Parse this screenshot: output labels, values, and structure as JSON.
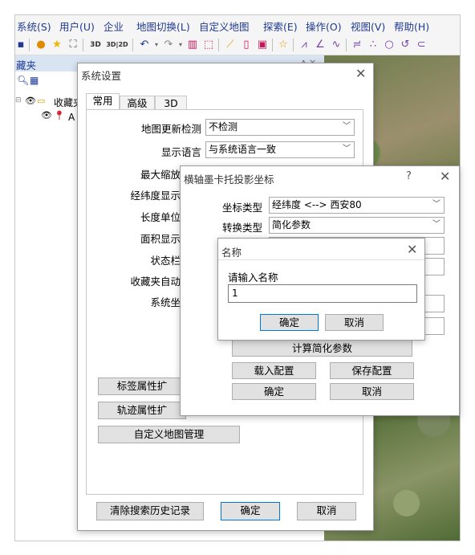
{
  "menu": [
    "系统(S)",
    "用户(U)",
    "企业",
    "地图切换(L)",
    "自定义地图",
    "探索(E)",
    "操作(O)",
    "视图(V)",
    "帮助(H)"
  ],
  "toolbar": {
    "btn_3d": "3D",
    "btn_32d": "3D|2D"
  },
  "panel": {
    "title": "藏夹",
    "pin": "ᴧ ×",
    "tree_root": "收藏夹",
    "tree_child": "A"
  },
  "settings": {
    "title": "系统设置",
    "tabs": [
      "常用",
      "高级",
      "3D"
    ],
    "labels": [
      "地图更新检测",
      "显示语言",
      "最大缩放",
      "经纬度显示",
      "长度单位",
      "面积显示",
      "状态栏",
      "收藏夹自动",
      "系统坐"
    ],
    "map_update_value": "不检测",
    "language_value": "与系统语言一致",
    "btn_label_attr": "标签属性扩",
    "btn_track_attr": "轨迹属性扩",
    "btn_custom_map": "自定义地图管理",
    "btn_clear_history": "清除搜索历史记录",
    "btn_ok": "确定",
    "btn_cancel": "取消"
  },
  "utm": {
    "title": "横轴墨卡托投影坐标",
    "help": "?",
    "coord_type_label": "坐标类型",
    "coord_type_value": "经纬度 <--> 西安80",
    "convert_type_label": "转换类型",
    "convert_type_value": "简化参数",
    "partial_label": "中",
    "btn_calc": "计算简化参数",
    "btn_load": "载入配置",
    "btn_save": "保存配置",
    "btn_ok": "确定",
    "btn_cancel": "取消"
  },
  "name_dialog": {
    "title": "名称",
    "prompt": "请输入名称",
    "input_value": "1",
    "btn_ok": "确定",
    "btn_cancel": "取消"
  }
}
